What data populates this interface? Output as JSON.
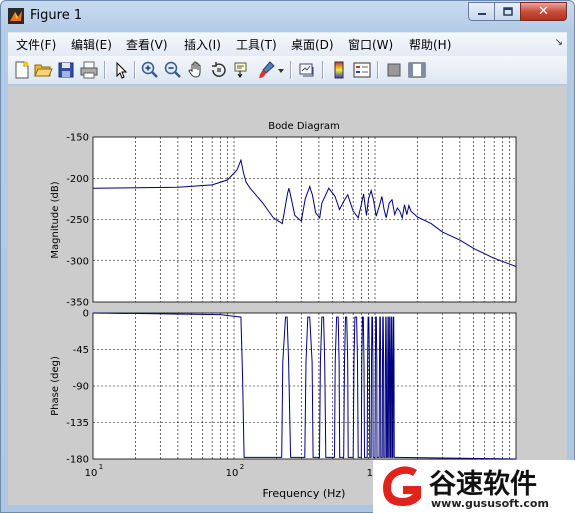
{
  "window": {
    "title": "Figure 1",
    "close_label": "✕"
  },
  "menu": [
    {
      "label": "文件(F)"
    },
    {
      "label": "编辑(E)"
    },
    {
      "label": "查看(V)"
    },
    {
      "label": "插入(I)"
    },
    {
      "label": "工具(T)"
    },
    {
      "label": "桌面(D)"
    },
    {
      "label": "窗口(W)"
    },
    {
      "label": "帮助(H)"
    }
  ],
  "toolbar": {
    "icons": [
      "new-figure-icon",
      "open-file-icon",
      "save-icon",
      "print-icon",
      "edit-plot-icon",
      "zoom-in-icon",
      "zoom-out-icon",
      "pan-icon",
      "rotate-3d-icon",
      "data-cursor-icon",
      "brush-icon",
      "link-plot-icon",
      "colorbar-icon",
      "legend-icon",
      "hide-plot-tools-icon",
      "show-plot-tools-icon"
    ]
  },
  "chart_data": {
    "type": "line",
    "title": "Bode Diagram",
    "xlabel": "Frequency  (Hz)",
    "xscale": "log",
    "xlim": [
      10,
      10000
    ],
    "x_ticks": [
      "10",
      "10",
      "10",
      "10"
    ],
    "x_tick_exponents": [
      "1",
      "2",
      "3",
      "4"
    ],
    "grid": true,
    "line_color": "#00007f",
    "panels": [
      {
        "name": "magnitude",
        "ylabel": "Magnitude (dB)",
        "ylim": [
          -350,
          -150
        ],
        "y_ticks": [
          "-150",
          "-200",
          "-250",
          "-300",
          "-350"
        ],
        "x": [
          10,
          40,
          70,
          90,
          105,
          112,
          117,
          122,
          130,
          160,
          190,
          220,
          240,
          245,
          250,
          270,
          300,
          320,
          345,
          350,
          360,
          380,
          405,
          420,
          470,
          520,
          560,
          600,
          640,
          700,
          760,
          800,
          830,
          850,
          870,
          900,
          940,
          980,
          1020,
          1080,
          1120,
          1160,
          1200,
          1260,
          1320,
          1380,
          1440,
          1500,
          1560,
          1620,
          1680,
          1740,
          1800,
          2000,
          2500,
          3000,
          4000,
          5000,
          7000,
          10000
        ],
        "y": [
          -212,
          -211,
          -208,
          -202,
          -190,
          -178,
          -194,
          -205,
          -212,
          -230,
          -248,
          -255,
          -218,
          -212,
          -218,
          -245,
          -252,
          -225,
          -210,
          -214,
          -220,
          -242,
          -248,
          -230,
          -212,
          -222,
          -238,
          -228,
          -220,
          -240,
          -248,
          -232,
          -219,
          -232,
          -245,
          -225,
          -215,
          -228,
          -246,
          -232,
          -222,
          -238,
          -248,
          -230,
          -226,
          -244,
          -236,
          -240,
          -248,
          -232,
          -244,
          -233,
          -240,
          -247,
          -255,
          -265,
          -275,
          -285,
          -297,
          -307
        ]
      },
      {
        "name": "phase",
        "ylabel": "Phase (deg)",
        "ylim": [
          -180,
          0
        ],
        "y_ticks": [
          "0",
          "-45",
          "-90",
          "-135",
          "-180"
        ],
        "x": [
          10,
          80,
          112,
          115,
          118,
          125,
          218,
          222,
          232,
          238,
          244,
          252,
          258,
          262,
          318,
          324,
          334,
          344,
          358,
          364,
          372,
          404,
          410,
          420,
          432,
          440,
          448,
          516,
          522,
          534,
          548,
          556,
          562,
          566,
          600,
          608,
          618,
          630,
          640,
          646,
          700,
          710,
          720,
          740,
          752,
          760,
          768,
          800,
          806,
          816,
          826,
          836,
          842,
          880,
          886,
          894,
          904,
          912,
          918,
          938,
          944,
          950,
          960,
          966,
          970,
          1000,
          1006,
          1012,
          1022,
          1030,
          1034,
          1070,
          1076,
          1082,
          1090,
          1096,
          1100,
          1124,
          1130,
          1136,
          1144,
          1150,
          1154,
          1180,
          1186,
          1192,
          1198,
          1204,
          1208,
          1224,
          1230,
          1236,
          1242,
          1246,
          1250,
          1260,
          1266,
          1272,
          1278,
          1284,
          1288,
          1300,
          1306,
          1312,
          1318,
          1324,
          1328,
          1340,
          1346,
          1352,
          1358,
          1364,
          1368,
          1400,
          10000
        ],
        "y": [
          0,
          -2,
          -5,
          -80,
          -178,
          -178,
          -178,
          -60,
          -5,
          -5,
          -60,
          -178,
          -178,
          -178,
          -178,
          -60,
          -5,
          -5,
          -60,
          -178,
          -178,
          -178,
          -60,
          -5,
          -5,
          -60,
          -178,
          -178,
          -60,
          -5,
          -5,
          -60,
          -178,
          -178,
          -178,
          -60,
          -5,
          -5,
          -60,
          -178,
          -178,
          -60,
          -5,
          -5,
          -60,
          -178,
          -178,
          -178,
          -60,
          -5,
          -5,
          -60,
          -178,
          -178,
          -60,
          -5,
          -5,
          -60,
          -178,
          -178,
          -60,
          -5,
          -5,
          -60,
          -178,
          -178,
          -60,
          -5,
          -5,
          -60,
          -178,
          -178,
          -60,
          -5,
          -5,
          -60,
          -178,
          -178,
          -60,
          -5,
          -5,
          -60,
          -178,
          -178,
          -60,
          -5,
          -5,
          -60,
          -178,
          -178,
          -60,
          -5,
          -5,
          -60,
          -178,
          -178,
          -60,
          -5,
          -5,
          -60,
          -178,
          -178,
          -60,
          -5,
          -5,
          -60,
          -178,
          -178,
          -60,
          -5,
          -5,
          -60,
          -178,
          -178,
          -180,
          -180
        ]
      }
    ]
  },
  "watermark": {
    "brand": "谷速软件",
    "url": "www.gususoft.com",
    "red": "#e0231c"
  }
}
